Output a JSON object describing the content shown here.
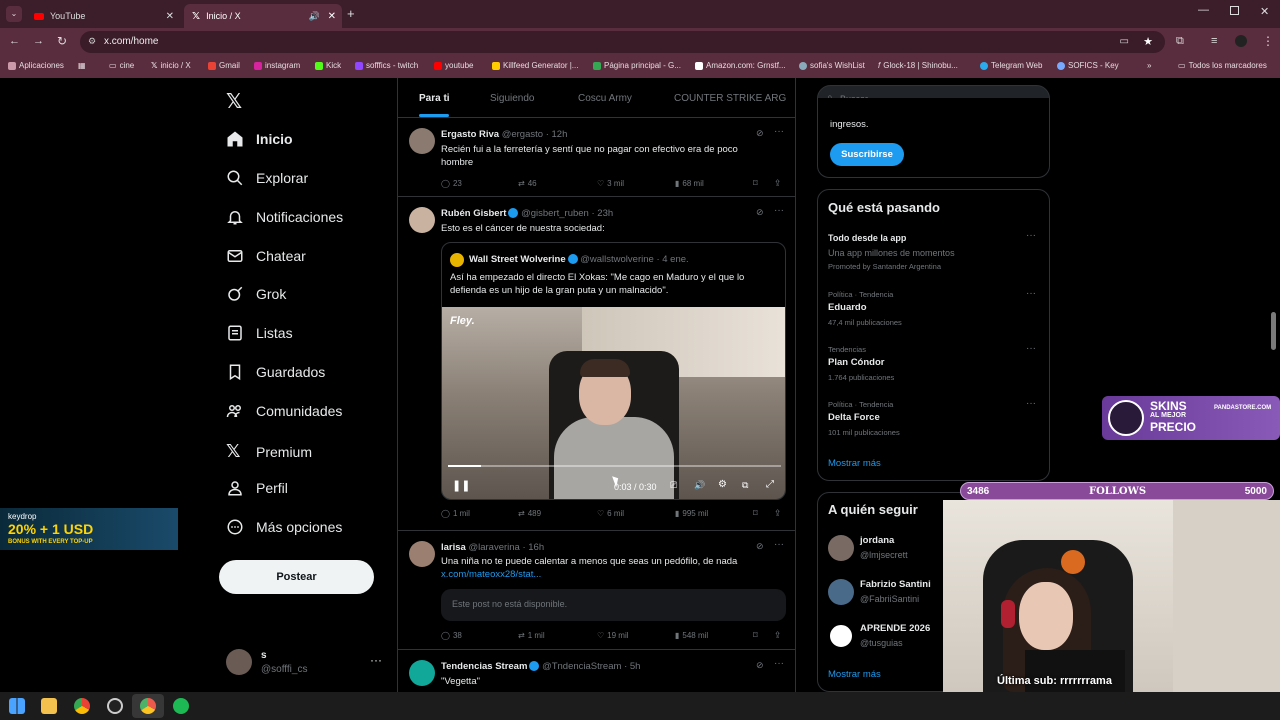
{
  "browser": {
    "tabs": [
      {
        "title": "YouTube"
      },
      {
        "title": "Inicio / X"
      }
    ],
    "url": "x.com/home",
    "bookmarks": [
      {
        "label": "Aplicaciones"
      },
      {
        "label": "cine"
      },
      {
        "label": "inicio / X"
      },
      {
        "label": "Gmail"
      },
      {
        "label": "instagram"
      },
      {
        "label": "Kick"
      },
      {
        "label": "sofffics - twitch"
      },
      {
        "label": "youtube"
      },
      {
        "label": "Killfeed Generator |..."
      },
      {
        "label": "Página principal - G..."
      },
      {
        "label": "Amazon.com: Grnstf..."
      },
      {
        "label": "sofia's WishList"
      },
      {
        "label": "Glock-18 | Shinobu..."
      },
      {
        "label": "Telegram Web"
      },
      {
        "label": "SOFICS - Key"
      },
      {
        "label": "Todos los marcadores"
      }
    ]
  },
  "sidebar": {
    "items": [
      {
        "label": "Inicio"
      },
      {
        "label": "Explorar"
      },
      {
        "label": "Notificaciones"
      },
      {
        "label": "Chatear"
      },
      {
        "label": "Grok"
      },
      {
        "label": "Listas"
      },
      {
        "label": "Guardados"
      },
      {
        "label": "Comunidades"
      },
      {
        "label": "Premium"
      },
      {
        "label": "Perfil"
      },
      {
        "label": "Más opciones"
      }
    ],
    "post_button": "Postear",
    "account": {
      "name": "s",
      "handle": "@sofffi_cs"
    }
  },
  "feed": {
    "tabs": [
      {
        "label": "Para ti"
      },
      {
        "label": "Siguiendo"
      },
      {
        "label": "Coscu Army"
      },
      {
        "label": "COUNTER STRIKE ARG"
      }
    ],
    "posts": [
      {
        "name": "Ergasto Riva",
        "handle": "@ergasto",
        "time": "· 12h",
        "text1": "Recién fui a la ferretería y sentí que no pagar con efectivo era de poco",
        "text2": "hombre",
        "replies": "23",
        "reposts": "46",
        "likes": "3 mil",
        "views": "68 mil"
      },
      {
        "name": "Rubén Gisbert",
        "handle": "@gisbert_ruben",
        "time": "· 23h",
        "text1": "Esto es el cáncer de nuestra sociedad:",
        "quote": {
          "name": "Wall Street Wolverine",
          "handle": "@wallstwolverine",
          "time": "· 4 ene.",
          "text1": "Así ha empezado el directo El Xokas: \"Me cago en Maduro y el que lo",
          "text2": "defienda es un hijo de la gran puta y un malnacido\".",
          "video_brand": "Fley.",
          "video_time": "0:03 / 0:30",
          "progress": 0.1
        },
        "replies": "1 mil",
        "reposts": "489",
        "likes": "6 mil",
        "views": "995 mil"
      },
      {
        "name": "larisa",
        "handle": "@laraverina",
        "time": "· 16h",
        "text1": "Una niña no te puede calentar a menos que seas un pedófilo, de nada",
        "link": "x.com/mateoxx28/stat...",
        "unavailable": "Este post no está disponible.",
        "replies": "38",
        "reposts": "1 mil",
        "likes": "19 mil",
        "views": "548 mil"
      },
      {
        "name": "Tendencias Stream",
        "handle": "@TndenciaStream",
        "time": "· 5h",
        "text1": "\"Vegetta\""
      }
    ]
  },
  "right": {
    "search_placeholder": "Buscar",
    "premium_text": "ingresos.",
    "subscribe": "Suscribirse",
    "trends_title": "Qué está pasando",
    "trends": [
      {
        "meta": "",
        "title": "Todo desde la app",
        "sub": "Una app millones de momentos",
        "promo": "Promoted by Santander Argentina"
      },
      {
        "meta": "Política · Tendencia",
        "title": "Eduardo",
        "sub": "47,4 mil publicaciones"
      },
      {
        "meta": "Tendencias",
        "title": "Plan Cóndor",
        "sub": "1.764 publicaciones"
      },
      {
        "meta": "Política · Tendencia",
        "title": "Delta Force",
        "sub": "101 mil publicaciones"
      }
    ],
    "show_more": "Mostrar más",
    "follow_title": "A quién seguir",
    "follow": [
      {
        "name": "jordana",
        "handle": "@lmjsecrett"
      },
      {
        "name": "Fabrizio Santini",
        "handle": "@FabriiSantini"
      },
      {
        "name": "APRENDE 2026",
        "handle": "@tusguias"
      }
    ],
    "follow_more": "Mostrar más"
  },
  "overlays": {
    "skins_line1": "SKINS",
    "skins_line2": "AL MEJOR",
    "skins_line3": "PRECIO",
    "skins_site": "PANDASTORE.COM",
    "follows_current": "3486",
    "follows_label": "FOLLOWS",
    "follows_goal": "5000",
    "keydrop_brand": "keydrop",
    "keydrop_promo": "20% + 1 USD",
    "keydrop_sub": "BONUS WITH EVERY TOP-UP",
    "last_sub": "Última sub: rrrrrrrama"
  },
  "colors": {
    "accent": "#1d9bf0",
    "chrome": "#5a2d3e",
    "follows_bar": "#8a4a9a"
  }
}
